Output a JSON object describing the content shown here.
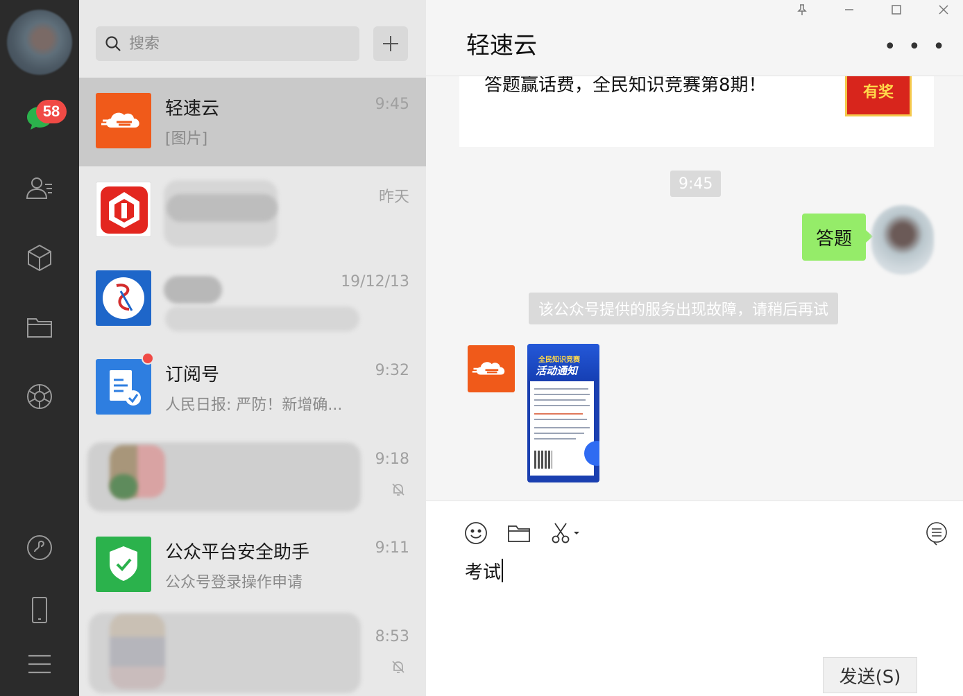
{
  "sidebar": {
    "unread_badge": "58",
    "icons": [
      "chat-icon",
      "contacts-icon",
      "favorites-icon",
      "files-icon",
      "moments-icon",
      "mini-programs-icon",
      "phone-icon",
      "menu-icon"
    ]
  },
  "search": {
    "placeholder": "搜索"
  },
  "conversations": [
    {
      "name": "轻速云",
      "preview": "[图片]",
      "time": "9:45"
    },
    {
      "name": "",
      "preview": "",
      "time": "昨天"
    },
    {
      "name": "",
      "preview": "",
      "time": "19/12/13"
    },
    {
      "name": "订阅号",
      "preview": "人民日报: 严防！新增确...",
      "time": "9:32"
    },
    {
      "name": "",
      "preview": "",
      "time": "9:18"
    },
    {
      "name": "公众平台安全助手",
      "preview": "公众号登录操作申请",
      "time": "9:11"
    },
    {
      "name": "",
      "preview": "",
      "time": "8:53"
    }
  ],
  "chat": {
    "title": "轻速云",
    "more_label": "• • •",
    "card_title": "答题赢话费，全民知识竞赛第8期！",
    "card_thumb_text": "有奖",
    "time_chip": "9:45",
    "outgoing_message": "答题",
    "system_notice": "该公众号提供的服务出现故障，请稍后再试",
    "poster_line1": "全民知识竞赛",
    "poster_line2": "活动通知"
  },
  "composer": {
    "text": "考试",
    "send_label": "发送(S)"
  },
  "colors": {
    "rail_bg": "#2b2b2b",
    "list_bg": "#e8e8e8",
    "active_row": "#c9c9c9",
    "bubble_green": "#95ec69",
    "badge_red": "#f04a45",
    "brand_orange": "#f05a1a"
  }
}
